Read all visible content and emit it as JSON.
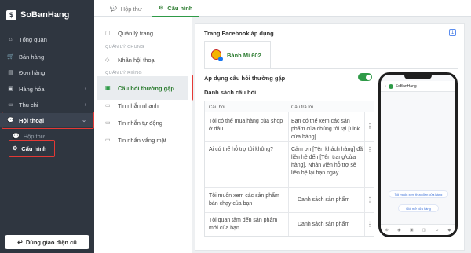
{
  "brand": {
    "name": "SoBanHang",
    "logo_letter": "$"
  },
  "sidebar": {
    "items": [
      {
        "label": "Tổng quan",
        "icon": "home-icon"
      },
      {
        "label": "Bán hàng",
        "icon": "cart-icon"
      },
      {
        "label": "Đơn hàng",
        "icon": "orders-icon"
      },
      {
        "label": "Hàng hóa",
        "icon": "box-icon"
      },
      {
        "label": "Thu chi",
        "icon": "wallet-icon"
      },
      {
        "label": "Hội thoại",
        "icon": "chat-icon"
      }
    ],
    "sub_items": [
      {
        "label": "Hộp thư",
        "icon": "inbox-icon"
      },
      {
        "label": "Cấu hình",
        "icon": "gear-icon"
      }
    ],
    "old_ui_button": "Dùng giao diện cũ"
  },
  "tabs": [
    {
      "label": "Hộp thư",
      "icon": "inbox-icon"
    },
    {
      "label": "Cấu hình",
      "icon": "gear-icon"
    }
  ],
  "submenu": {
    "items": [
      {
        "label": "Quản lý trang"
      },
      {
        "label": "Nhãn hội thoại"
      },
      {
        "label": "Câu hỏi thường gặp"
      },
      {
        "label": "Tin nhắn nhanh"
      },
      {
        "label": "Tin nhắn tự động"
      },
      {
        "label": "Tin nhắn vắng mặt"
      }
    ],
    "sections": {
      "general": "QUẢN LÝ CHUNG",
      "specific": "QUẢN LÝ RIÊNG"
    }
  },
  "content": {
    "fb_title": "Trang Facebook áp dụng",
    "page_count": "1",
    "page_name": "Bánh Mì 602",
    "apply_label": "Áp dụng câu hỏi thường gặp",
    "apply_enabled": true,
    "list_title": "Danh sách câu hỏi",
    "table": {
      "headers": {
        "question": "Câu hỏi",
        "answer": "Câu trả lời"
      },
      "rows": [
        {
          "question": "Tôi có thể mua hàng của shop ở đâu",
          "answer": "Bạn có thể xem các sản phẩm của chúng tôi tại [Link cửa hàng]"
        },
        {
          "question": "Ai có thể hỗ trợ tôi không?",
          "answer": "Cảm ơn [Tên khách hàng] đã liên hệ đến [Tên trang/cửa hàng]. Nhân viên hỗ trợ sẽ liên hệ lại bạn ngay"
        },
        {
          "question": "Tôi muốn xem các sản phẩm bán chạy của bạn",
          "answer": "Danh sách sản phẩm"
        },
        {
          "question": "Tôi quan tâm đến sản phẩm mới của bạn",
          "answer": "Danh sách sản phẩm"
        }
      ],
      "more_symbol": "⋮"
    }
  },
  "phone": {
    "header_name": "SoBanHang",
    "quick_questions": [
      "Tôi muốn xem thực đơn cửa hàng",
      "Giờ mở cửa hàng"
    ]
  },
  "colors": {
    "accent": "#2e9a47",
    "sidebar_bg": "#2f3640",
    "highlight": "#e53935"
  }
}
